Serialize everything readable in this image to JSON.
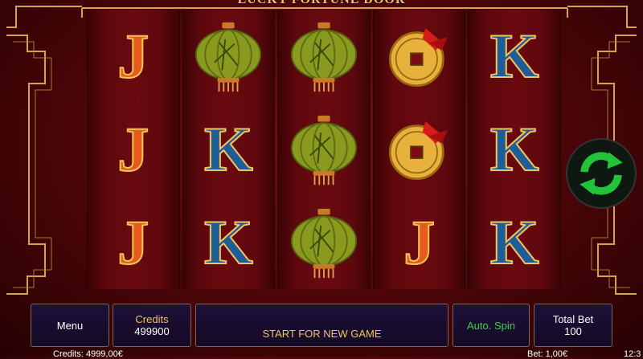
{
  "game": {
    "title": "LUCKY FORTUNE DOOR"
  },
  "reels": [
    [
      "J",
      "J",
      "J"
    ],
    [
      "lantern",
      "K",
      "K"
    ],
    [
      "lantern",
      "lantern",
      "lantern"
    ],
    [
      "coin",
      "coin",
      "J"
    ],
    [
      "K",
      "K",
      "K"
    ]
  ],
  "controls": {
    "menu_label": "Menu",
    "credits_label": "Credits",
    "credits_value": "499900",
    "start_label": "START FOR NEW GAME",
    "auto_spin_label": "Auto. Spin",
    "total_bet_label": "Total Bet",
    "total_bet_value": "100"
  },
  "status": {
    "credits_text": "Credits: 4999,00€",
    "bet_text": "Bet: 1,00€",
    "clock_text": "12:3"
  },
  "colors": {
    "background": "#5a070b",
    "frame_gold": "#d8a44a",
    "refresh_green": "#22c33a",
    "button_bg": "#1a0d30"
  },
  "icons": {
    "spin": "refresh-arrows-icon"
  }
}
